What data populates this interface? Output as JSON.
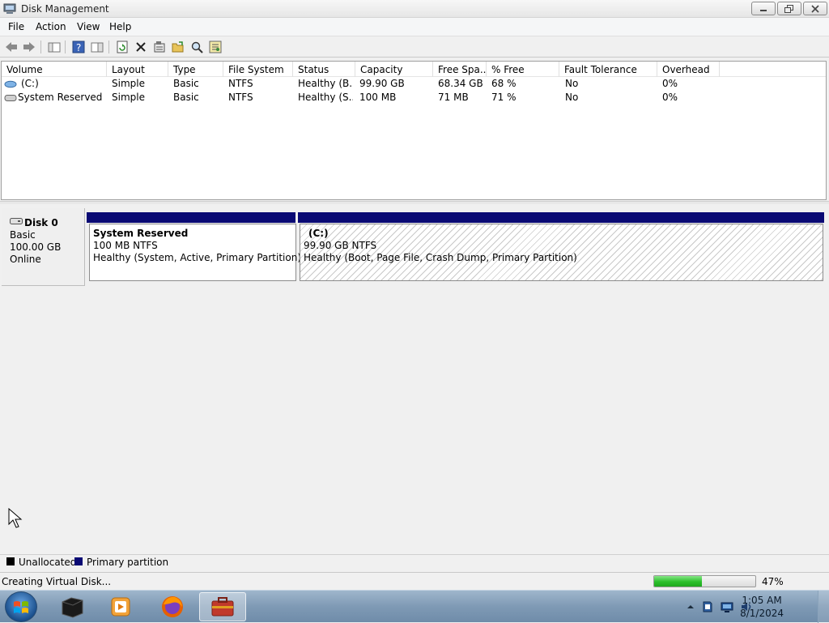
{
  "window": {
    "title": "Disk Management",
    "controls": {
      "minimize": "minimize",
      "restore": "restore",
      "close": "close"
    }
  },
  "menu": [
    "File",
    "Action",
    "View",
    "Help"
  ],
  "toolbar": {
    "icons": [
      "back-icon",
      "forward-icon",
      "console-tree-icon",
      "help-icon",
      "properties-view-icon",
      "refresh-icon",
      "delete-icon",
      "properties-icon",
      "open-icon",
      "explore-icon",
      "settings-icon"
    ]
  },
  "volumes": {
    "columns": [
      "Volume",
      "Layout",
      "Type",
      "File System",
      "Status",
      "Capacity",
      "Free Spa...",
      "% Free",
      "Fault Tolerance",
      "Overhead"
    ],
    "rows": [
      [
        "(C:)",
        "Simple",
        "Basic",
        "NTFS",
        "Healthy (B...",
        "99.90 GB",
        "68.34 GB",
        "68 %",
        "No",
        "0%"
      ],
      [
        "System Reserved",
        "Simple",
        "Basic",
        "NTFS",
        "Healthy (S...",
        "100 MB",
        "71 MB",
        "71 %",
        "No",
        "0%"
      ]
    ]
  },
  "disk": {
    "name": "Disk 0",
    "type": "Basic",
    "size": "100.00 GB",
    "state": "Online",
    "partitions": [
      {
        "name": "System Reserved",
        "size": "100 MB NTFS",
        "status": "Healthy (System, Active, Primary Partition)"
      },
      {
        "name": "(C:)",
        "size": "99.90 GB NTFS",
        "status": "Healthy (Boot, Page File, Crash Dump, Primary Partition)"
      }
    ]
  },
  "legend": {
    "unallocated": "Unallocated",
    "primary": "Primary partition",
    "colors": {
      "unallocated": "#000000",
      "primary": "#0a0a74"
    }
  },
  "status": {
    "text": "Creating Virtual Disk...",
    "progress_percent": 47,
    "progress_label": "47%"
  },
  "taskbar": {
    "apps": [
      "console-window-icon",
      "media-player-icon",
      "firefox-icon",
      "disk-management-icon"
    ],
    "tray": [
      "show-hidden-icons-icon",
      "action-center-icon",
      "network-icon",
      "volume-icon"
    ],
    "time": "1:05 AM",
    "date": "8/1/2024"
  }
}
